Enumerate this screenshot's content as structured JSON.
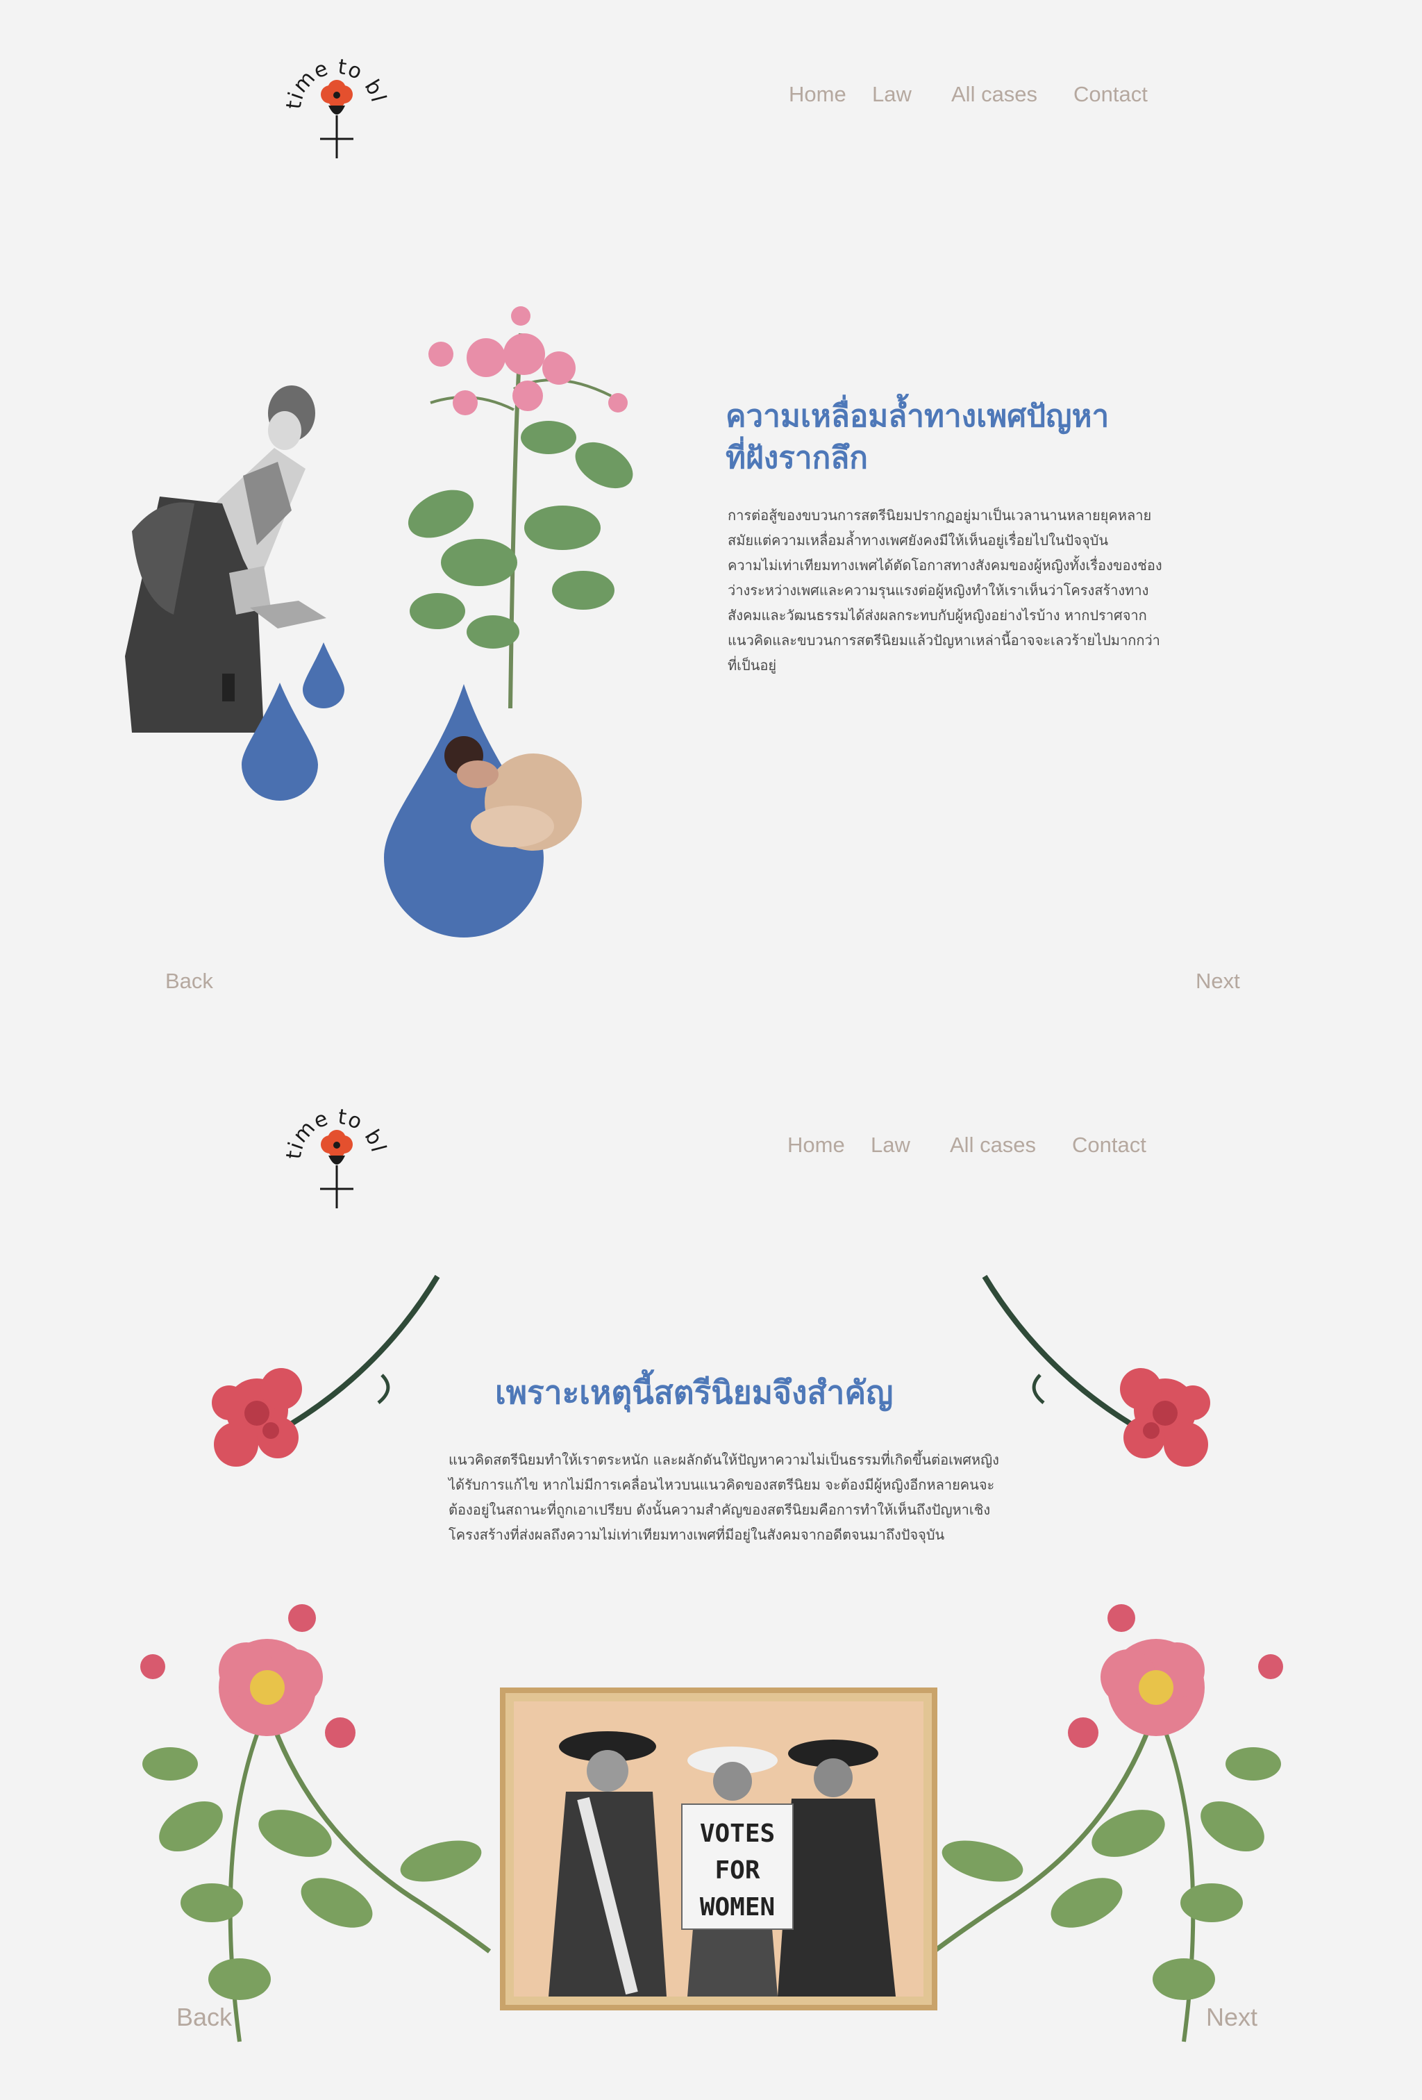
{
  "logo": {
    "text": "time to bloom"
  },
  "section1": {
    "nav": {
      "home": "Home",
      "law": "Law",
      "cases": "All cases",
      "contact": "Contact"
    },
    "title_line1": "ความเหลื่อมล้ำทางเพศปัญหา",
    "title_line2": "ที่ฝังรากลึก",
    "body_lines": [
      "การต่อสู้ของขบวนการสตรีนิยมปรากฏอยู่มาเป็นเวลานานหลายยุคหลาย",
      "สมัยแต่ความเหลื่อมล้ำทางเพศยังคงมีให้เห็นอยู่เรื่อยไปในปัจจุบัน",
      "ความไม่เท่าเทียมทางเพศได้ตัดโอกาสทางสังคมของผู้หญิงทั้งเรื่องของช่อง",
      "ว่างระหว่างเพศและความรุนแรงต่อผู้หญิงทำให้เราเห็นว่าโครงสร้างทาง",
      "สังคมและวัฒนธรรมได้ส่งผลกระทบกับผู้หญิงอย่างไรบ้าง  หากปราศจาก",
      "แนวคิดและขบวนการสตรีนิยมแล้วปัญหาเหล่านี้อาจจะเลวร้ายไปมากกว่า",
      "ที่เป็นอยู่"
    ],
    "back": "Back",
    "next": "Next"
  },
  "section2": {
    "nav": {
      "home": "Home",
      "law": "Law",
      "cases": "All cases",
      "contact": "Contact"
    },
    "title": "เพราะเหตุนี้สตรีนิยมจึงสำคัญ",
    "body_lines": [
      "แนวคิดสตรีนิยมทำให้เราตระหนัก  และผลักดันให้ปัญหาความไม่เป็นธรรมที่เกิดขึ้นต่อเพศหญิง",
      "ได้รับการแก้ไข  หากไม่มีการเคลื่อนไหวบนแนวคิดของสตรีนิยม  จะต้องมีผู้หญิงอีกหลายคนจะ",
      "ต้องอยู่ในสถานะที่ถูกเอาเปรียบ  ดังนั้นความสำคัญของสตรีนิยมคือการทำให้เห็นถึงปัญหาเชิง",
      "โครงสร้างที่ส่งผลถึงความไม่เท่าเทียมทางเพศที่มีอยู่ในสังคมจากอดีตจนมาถึงปัจจุบัน"
    ],
    "sign_line1": "VOTES",
    "sign_line2": "FOR",
    "sign_line3": "WOMEN",
    "back": "Back",
    "next": "Next"
  },
  "colors": {
    "accent": "#4e78b8",
    "nav": "#b5a89f",
    "poppy": "#e4502e",
    "drop": "#4a70b0"
  }
}
